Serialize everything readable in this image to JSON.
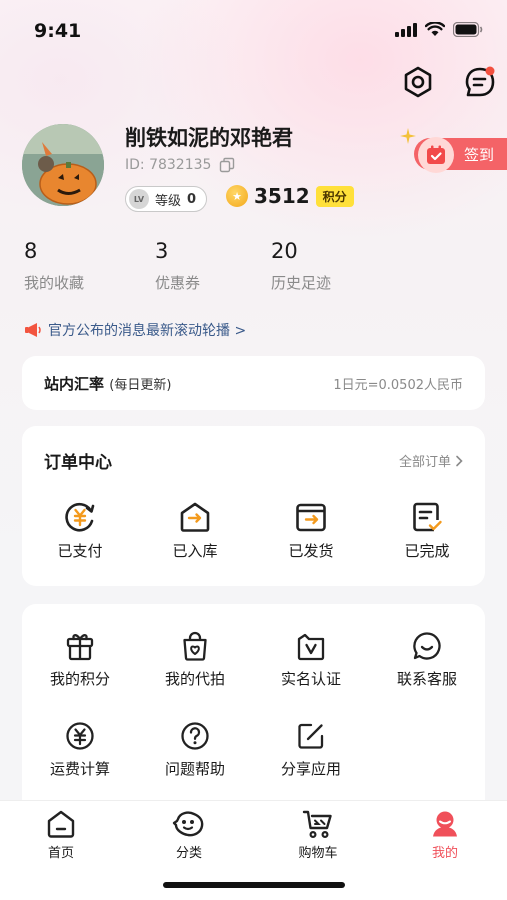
{
  "status_bar": {
    "time": "9:41"
  },
  "profile": {
    "username": "削铁如泥的邓艳君",
    "user_id": "ID: 7832135",
    "level_badge": "LV",
    "level_label": "等级",
    "level_value": "0",
    "points": "3512",
    "points_tag": "积分",
    "checkin_label": "签到"
  },
  "stats": [
    {
      "value": "8",
      "label": "我的收藏"
    },
    {
      "value": "3",
      "label": "优惠券"
    },
    {
      "value": "20",
      "label": "历史足迹"
    }
  ],
  "notice": {
    "text": "官方公布的消息最新滚动轮播 >"
  },
  "exchange_rate": {
    "title": "站内汇率",
    "subtitle": "(每日更新)",
    "value": "1日元=0.0502人民币"
  },
  "orders": {
    "title": "订单中心",
    "more": "全部订单",
    "items": [
      {
        "label": "已支付",
        "icon": "paid-icon"
      },
      {
        "label": "已入库",
        "icon": "warehouse-icon"
      },
      {
        "label": "已发货",
        "icon": "shipped-icon"
      },
      {
        "label": "已完成",
        "icon": "completed-icon"
      }
    ]
  },
  "tools": {
    "items": [
      {
        "label": "我的积分",
        "icon": "gift-icon"
      },
      {
        "label": "我的代拍",
        "icon": "shopping-bag-icon"
      },
      {
        "label": "实名认证",
        "icon": "verify-icon"
      },
      {
        "label": "联系客服",
        "icon": "chat-icon"
      },
      {
        "label": "运费计算",
        "icon": "yen-icon"
      },
      {
        "label": "问题帮助",
        "icon": "help-icon"
      },
      {
        "label": "分享应用",
        "icon": "share-icon"
      }
    ]
  },
  "nav": {
    "items": [
      {
        "label": "首页",
        "icon": "home-icon"
      },
      {
        "label": "分类",
        "icon": "category-icon"
      },
      {
        "label": "购物车",
        "icon": "cart-icon"
      },
      {
        "label": "我的",
        "icon": "profile-icon",
        "active": true
      }
    ]
  },
  "colors": {
    "accent": "#f0505a",
    "checkin": "#f46367",
    "points_tag": "#ffe03a",
    "order_accent": "#f39a1d",
    "notice_text": "#3a5a8a"
  }
}
